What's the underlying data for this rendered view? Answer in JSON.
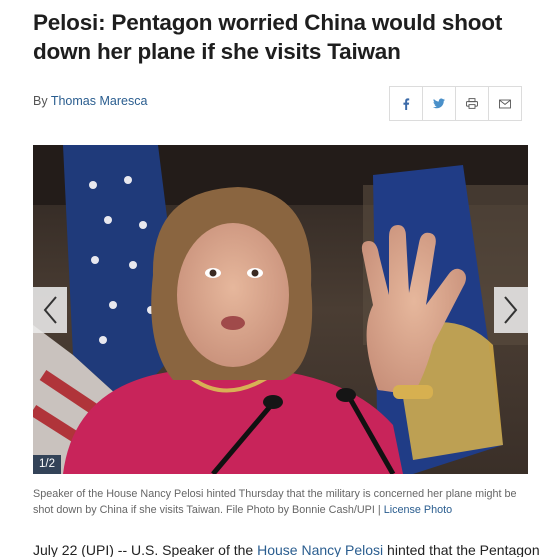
{
  "article": {
    "headline_line1": "Pelosi: Pentagon worried China would shoot",
    "headline_line2": "down her plane if she visits Taiwan",
    "byline_prefix": "By",
    "author": "Thomas Maresca"
  },
  "share": {
    "icons": [
      "facebook-icon",
      "twitter-icon",
      "print-icon",
      "email-icon"
    ]
  },
  "gallery": {
    "counter": "1/2",
    "caption_text": "Speaker of the House Nancy Pelosi hinted Thursday that the military is concerned her plane might be shot down by China if she visits Taiwan. File Photo by Bonnie Cash/UPI",
    "caption_sep": " | ",
    "license_link": "License Photo"
  },
  "body": {
    "lead_start": "July 22 (UPI) -- U.S. Speaker of the ",
    "lead_link": "House Nancy Pelosi",
    "lead_end": " hinted that the Pentagon"
  },
  "colors": {
    "link": "#2a5d8f",
    "counter_bg": "#1f3650"
  }
}
